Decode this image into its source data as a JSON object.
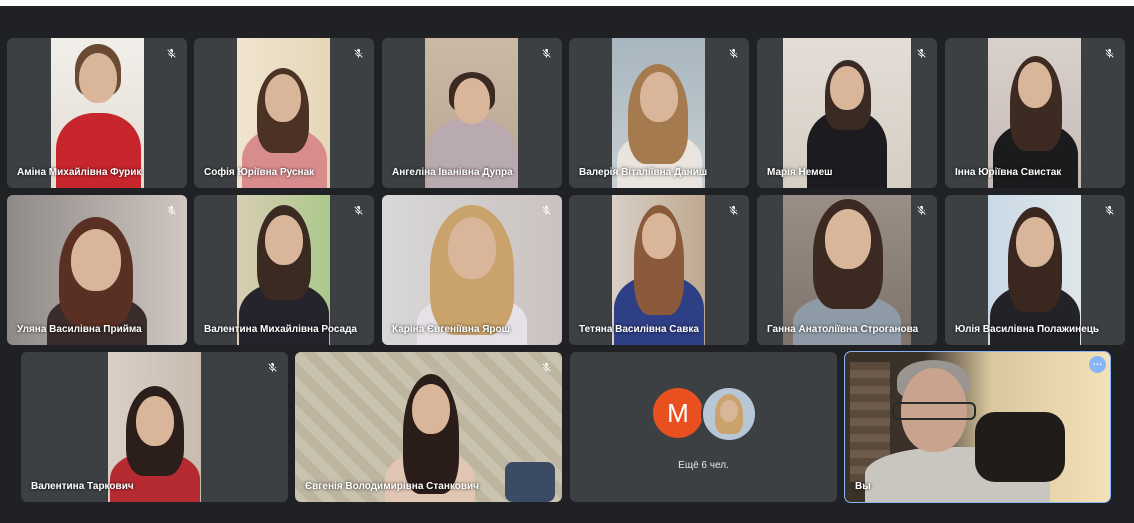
{
  "participants": [
    {
      "name": "Аміна Михайлівна Фурик",
      "muted": true
    },
    {
      "name": "Софія Юріївна Руснак",
      "muted": true
    },
    {
      "name": "Ангеліна Іванівна Дупра",
      "muted": true
    },
    {
      "name": "Валерія Віталіївна Даниш",
      "muted": true
    },
    {
      "name": "Марія Немеш",
      "muted": true
    },
    {
      "name": "Інна Юріївна Свистак",
      "muted": true
    },
    {
      "name": "Уляна Василівна Прийма",
      "muted": true
    },
    {
      "name": "Валентина Михайлівна Росада",
      "muted": true
    },
    {
      "name": "Каріна Євгеніївна Ярош",
      "muted": true
    },
    {
      "name": "Тетяна Василівна Савка",
      "muted": true
    },
    {
      "name": "Ганна Анатоліївна Строганова",
      "muted": true
    },
    {
      "name": "Юлія Василівна Полажинець",
      "muted": true
    },
    {
      "name": "Валентина Таркович",
      "muted": true
    },
    {
      "name": "Євгенія Володимирівна Станкович",
      "muted": true
    }
  ],
  "overflow_tile": {
    "avatar_letter": "M",
    "avatar_color": "#e8511f",
    "label": "Ещё 6 чел."
  },
  "self_tile": {
    "name": "Вы",
    "more_icon": "more-options-icon",
    "accent": "#8ab4f8"
  },
  "colors": {
    "background": "#202124",
    "tile": "#3c4043",
    "active_outline": "#8ab4f8"
  },
  "icons": {
    "mute": "mic-off-icon"
  }
}
